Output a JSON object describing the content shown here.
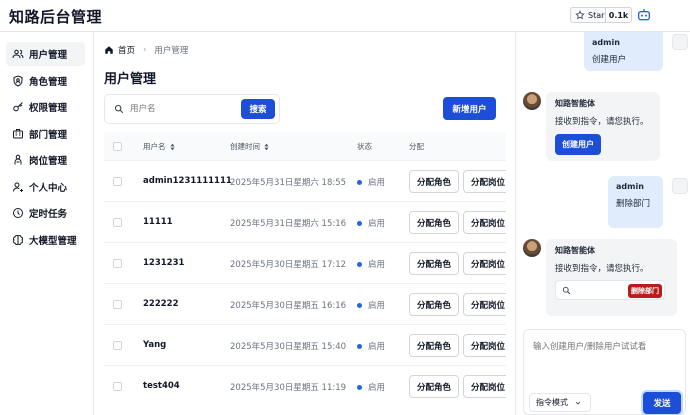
{
  "app": {
    "title": "知路后台管理",
    "star_label": "Star",
    "star_count": "0.1k"
  },
  "sidebar": {
    "items": [
      {
        "label": "用户管理",
        "icon": "users-icon",
        "active": true
      },
      {
        "label": "角色管理",
        "icon": "shield-icon",
        "active": false
      },
      {
        "label": "权限管理",
        "icon": "key-icon",
        "active": false
      },
      {
        "label": "部门管理",
        "icon": "building-icon",
        "active": false
      },
      {
        "label": "岗位管理",
        "icon": "briefcase-icon",
        "active": false
      },
      {
        "label": "个人中心",
        "icon": "user-icon",
        "active": false
      },
      {
        "label": "定时任务",
        "icon": "clock-icon",
        "active": false
      },
      {
        "label": "大模型管理",
        "icon": "brain-icon",
        "active": false
      }
    ]
  },
  "breadcrumb": {
    "home": "首页",
    "current": "用户管理"
  },
  "page": {
    "title": "用户管理",
    "search_placeholder": "用户名",
    "search_button": "搜索",
    "add_button": "新增用户"
  },
  "table": {
    "headers": {
      "name": "用户名",
      "created": "创建时间",
      "status": "状态",
      "assign": "分配"
    },
    "actions": {
      "assign_role": "分配角色",
      "assign_post": "分配岗位"
    },
    "rows": [
      {
        "name": "admin1231111111",
        "created": "2025年5月31日星期六 18:55",
        "status": "启用"
      },
      {
        "name": "11111",
        "created": "2025年5月31日星期六 15:16",
        "status": "启用"
      },
      {
        "name": "1231231",
        "created": "2025年5月30日星期五 17:12",
        "status": "启用"
      },
      {
        "name": "222222",
        "created": "2025年5月30日星期五 16:16",
        "status": "启用"
      },
      {
        "name": "Yang",
        "created": "2025年5月30日星期五 15:40",
        "status": "启用"
      },
      {
        "name": "test404",
        "created": "2025年5月30日星期五 11:19",
        "status": "启用"
      }
    ]
  },
  "chat": {
    "messages": [
      {
        "role": "user",
        "sender": "admin",
        "text": "创建用户"
      },
      {
        "role": "bot",
        "sender": "知路智能体",
        "text": "接收到指令，请您执行。",
        "action": "创建用户"
      },
      {
        "role": "user",
        "sender": "admin",
        "text": "删除部门"
      },
      {
        "role": "bot",
        "sender": "知路智能体",
        "text": "接收到指令，请您执行。",
        "action": "删除部门"
      }
    ],
    "input_placeholder": "输入创建用户/删除用户试试看",
    "mode": "指令模式",
    "send_button": "发送"
  },
  "colors": {
    "primary": "#1d4ed8",
    "danger": "#b91c1c",
    "user_bubble": "#e0ebfb",
    "bot_bubble": "#f3f4f6"
  }
}
